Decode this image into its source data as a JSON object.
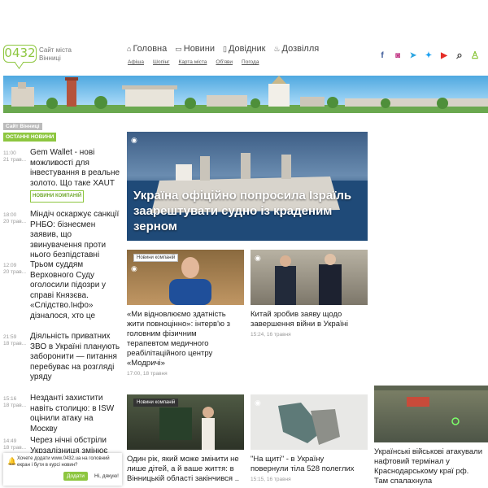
{
  "header": {
    "logo": "0432",
    "logo_sub": "Сайт міста Вінниці",
    "nav": [
      {
        "label": "Головна",
        "icon": "home-icon",
        "glyph": "⌂"
      },
      {
        "label": "Новини",
        "icon": "chat-icon",
        "glyph": "▭"
      },
      {
        "label": "Довідник",
        "icon": "book-icon",
        "glyph": "▯"
      },
      {
        "label": "Дозвілля",
        "icon": "drama-icon",
        "glyph": "♨"
      }
    ],
    "subnav": [
      "Афіша",
      "Шопінг",
      "Карта міста",
      "Об'яви",
      "Погода"
    ],
    "social": [
      {
        "name": "facebook-icon",
        "glyph": "f",
        "color": "#3b5998"
      },
      {
        "name": "instagram-icon",
        "glyph": "◙",
        "color": "#c13584"
      },
      {
        "name": "telegram-icon",
        "glyph": "➤",
        "color": "#2ca5e0"
      },
      {
        "name": "twitter-icon",
        "glyph": "✦",
        "color": "#1da1f2"
      },
      {
        "name": "youtube-icon",
        "glyph": "▶",
        "color": "#e52d27"
      },
      {
        "name": "search-icon",
        "glyph": "⌕",
        "color": "#444"
      },
      {
        "name": "user-icon",
        "glyph": "♙",
        "color": "#8dc63f"
      }
    ]
  },
  "left": {
    "tag_site": "Сайт Вінниці",
    "tag_latest": "ОСТАННІ НОВИНИ",
    "items": [
      {
        "time": "11:00",
        "date": "21 трав...",
        "title": "Gem Wallet - нові можливості для інвестування в реальне золото. Що таке XAUT",
        "badge": "НОВИНИ КОМПАНІЙ"
      },
      {
        "time": "18:00",
        "date": "20 трав...",
        "title": "Міндіч оскаржує санкції РНБО: бізнесмен заявив, що звинувачення проти нього безпідставні",
        "badge": ""
      },
      {
        "time": "12:09",
        "date": "20 трав...",
        "title": "Трьом суддям Верховного Суду оголосили підозри у справі Князєва. «Слідство.Інфо» дізналося, хто це",
        "badge": ""
      },
      {
        "time": "21:59",
        "date": "18 трав...",
        "title": "Діяльність приватних ЗВО в Україні планують заборонити — питання перебуває на розгляді уряду",
        "badge": ""
      },
      {
        "time": "15:16",
        "date": "18 трав...",
        "title": "Незданті захистити навіть столицю: в ISW оцінили атаку на Москву",
        "badge": ""
      },
      {
        "time": "14:49",
        "date": "18 трав...",
        "title": "Через нічні обстріли Укрзалізниця змінює рух",
        "badge": ""
      }
    ]
  },
  "feature": {
    "title": "Україна офіційно попросила Ізраїль заарештувати судно із краденим зерном"
  },
  "cards": [
    {
      "badge": "Новини компаній",
      "title": "«Ми відновлюємо здатність жити повноцінно»: інтерв'ю з головним фізичним терапевтом медичного реабілітаційного центру «Модричі»",
      "meta": "17:00, 18 травня"
    },
    {
      "badge": "",
      "title": "Китай зробив заяву щодо завершення війни в Україні",
      "meta": "15:24, 16 травня"
    },
    {
      "badge": "Новини компаній",
      "title": "Один рік, який може змінити не лише дітей, а й ваше життя: в Вінницькій області закінчився ..",
      "meta": ""
    },
    {
      "badge": "",
      "title": "\"На щиті\" - в Україну повернули тіла 528 полеглих",
      "meta": "15:15, 16 травня"
    },
    {
      "badge": "",
      "title": "Українські військові атакували нафтовий термінал у Краснодарському краї рф. Там спалахнула",
      "meta": ""
    }
  ],
  "promo": {
    "text": "Хочете додати www.0432.ua на головний екран і бути в курсі новин?",
    "yes": "Додати",
    "no": "Ні, дякую!"
  },
  "colors": {
    "accent": "#8dc63f"
  }
}
